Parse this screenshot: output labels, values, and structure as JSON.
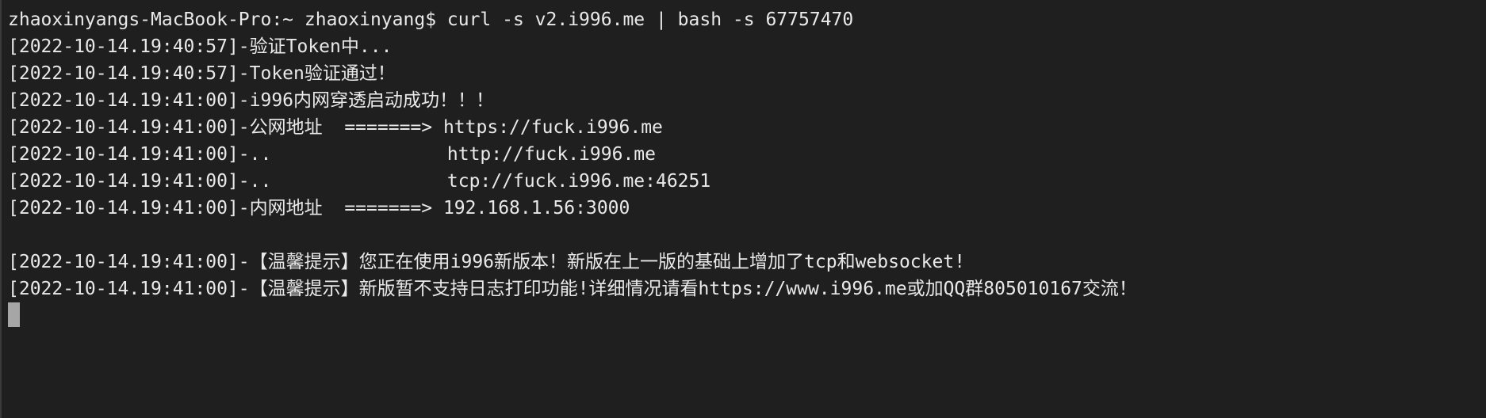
{
  "terminal": {
    "lines": [
      "zhaoxinyangs-MacBook-Pro:~ zhaoxinyang$ curl -s v2.i996.me | bash -s 67757470",
      "[2022-10-14.19:40:57]-验证Token中...",
      "[2022-10-14.19:40:57]-Token验证通过！",
      "[2022-10-14.19:41:00]-i996内网穿透启动成功！！！",
      "[2022-10-14.19:41:00]-公网地址  =======> https://fuck.i996.me",
      "[2022-10-14.19:41:00]-..                http://fuck.i996.me",
      "[2022-10-14.19:41:00]-..                tcp://fuck.i996.me:46251",
      "[2022-10-14.19:41:00]-内网地址  =======> 192.168.1.56:3000",
      "",
      "[2022-10-14.19:41:00]-【温馨提示】您正在使用i996新版本！新版在上一版的基础上增加了tcp和websocket!",
      "[2022-10-14.19:41:00]-【温馨提示】新版暂不支持日志打印功能!详细情况请看https://www.i996.me或加QQ群805010167交流！"
    ],
    "colors": {
      "background": "#1f1f1f",
      "text": "#e9e9e9",
      "cursor": "#a6a6a6"
    }
  }
}
